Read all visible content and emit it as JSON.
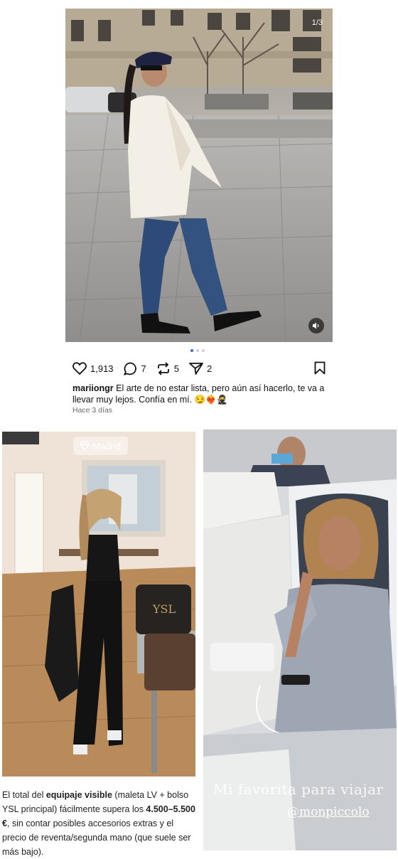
{
  "post": {
    "counter": "1/3",
    "likes": "1,913",
    "comments": "7",
    "reposts": "5",
    "shares": "2",
    "username": "mariiongr",
    "caption": "El arte de no estar lista, pero aún así hacerlo, te va a llevar muy lejos. Confía en mí. 😏❤️‍🔥🥷",
    "timestamp": "Hace 3 días",
    "carousel_total": 3,
    "carousel_active": 1
  },
  "left_card": {
    "location": "Madrid",
    "text_part1": "El total del ",
    "text_bold1": "equipaje visible",
    "text_part2": " (maleta LV + bolso YSL principal) fácilmente supera los ",
    "text_bold2": "4.500–5.500 €",
    "text_part3": ", sin contar posibles accesorios extras y el precio de reventa/segunda mano (que suele ser más bajo)."
  },
  "right_card": {
    "story_text": "Mi favorita para viajar",
    "story_mention": "@monpiccolo"
  },
  "icons": {
    "like": "heart-icon",
    "comment": "comment-icon",
    "repost": "repost-icon",
    "share": "send-icon",
    "save": "bookmark-icon",
    "sound": "speaker-icon",
    "location": "location-pin-icon"
  }
}
